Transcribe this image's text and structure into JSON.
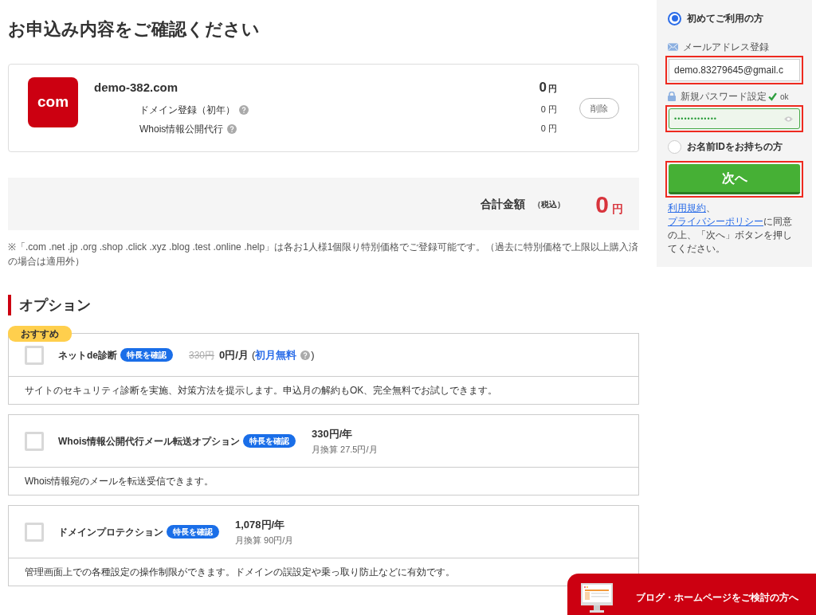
{
  "page_title": "お申込み内容をご確認ください",
  "order": {
    "tld_label": "com",
    "domain": "demo-382.com",
    "price": "0",
    "yen": "円",
    "delete_button": "削除",
    "lines": [
      {
        "label": "ドメイン登録（初年）",
        "price": "0",
        "yen": "円"
      },
      {
        "label": "Whois情報公開代行",
        "price": "0",
        "yen": "円"
      }
    ]
  },
  "total": {
    "label": "合計金額",
    "tax": "（税込）",
    "amount": "0",
    "yen": "円"
  },
  "footnote": "※「.com .net .jp .org .shop .click .xyz .blog .test .online .help」は各お1人様1個限り特別価格でご登録可能です。（過去に特別価格で上限以上購入済の場合は適用外）",
  "options_heading": "オプション",
  "options": [
    {
      "badge": "おすすめ",
      "name": "ネットde診断",
      "feature_link": "特長を確認",
      "old_price": "330円",
      "price": "0円/月",
      "note_open": "(",
      "note": "初月無料",
      "note_close": ")",
      "checked": false,
      "description": "サイトのセキュリティ診断を実施、対策方法を提示します。申込月の解約もOK、完全無料でお試しできます。"
    },
    {
      "name": "Whois情報公開代行メール転送オプション",
      "feature_link": "特長を確認",
      "price": "330円/年",
      "monthly": "月換算 27.5円/月",
      "checked": false,
      "description": "Whois情報宛のメールを転送受信できます。"
    },
    {
      "name": "ドメインプロテクション",
      "feature_link": "特長を確認",
      "price": "1,078円/年",
      "monthly": "月換算 90円/月",
      "checked": false,
      "description": "管理画面上での各種設定の操作制限ができます。ドメインの誤設定や乗っ取り防止などに有効です。"
    }
  ],
  "sidebar": {
    "new_user": {
      "label": "初めてご利用の方",
      "selected": true
    },
    "email": {
      "label": "メールアドレス登録",
      "value": "demo.83279645@gmail.c",
      "highlighted": true
    },
    "password": {
      "label": "新規パスワード設定",
      "status": "ok",
      "valid": true,
      "value": "•••••••••••••",
      "highlighted": true
    },
    "existing_user": {
      "label": "お名前IDをお持ちの方",
      "selected": false
    },
    "next_button": {
      "label": "次へ",
      "highlighted": true
    },
    "terms_link": "利用規約",
    "sep": "、",
    "privacy_link": "プライバシーポリシー",
    "agreement": "に同意の上、「次へ」ボタンを押してください。"
  },
  "banner": {
    "label": "ブログ・ホームページをご検討の方へ"
  }
}
